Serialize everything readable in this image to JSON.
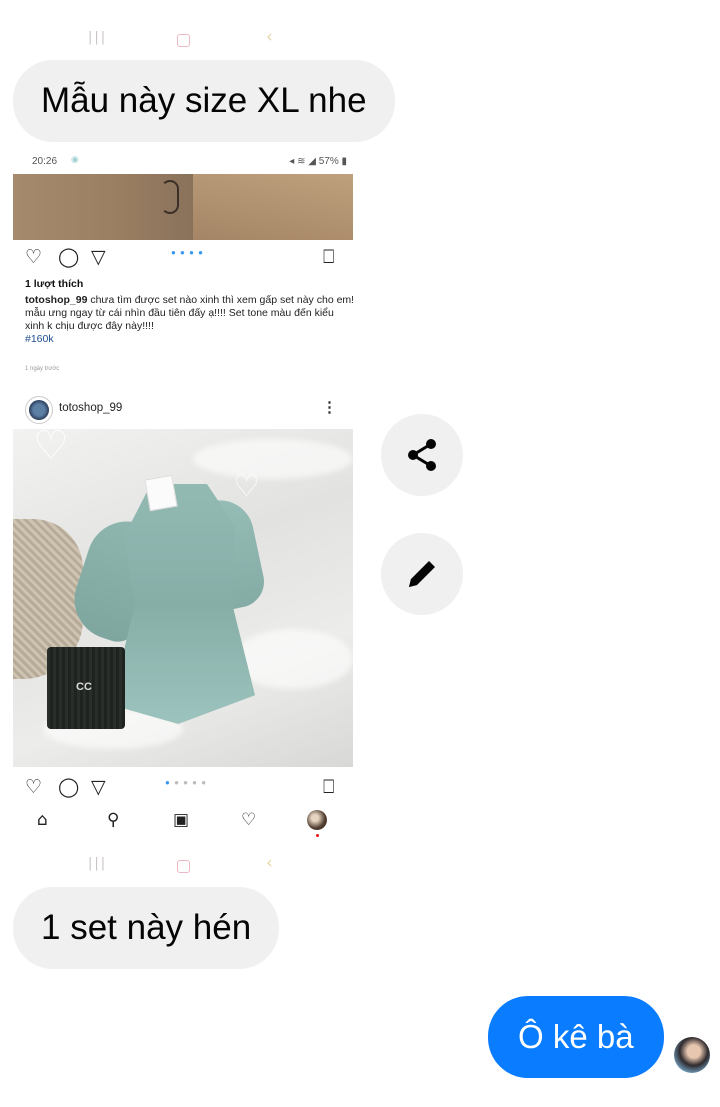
{
  "messages": {
    "msg1": "Mẫu này size XL nhe",
    "msg2": "1 set này hén",
    "reply": "Ô kê bà"
  },
  "screenshot": {
    "status_time": "20:26",
    "status_right": "57%",
    "likes": "1 lượt thích",
    "caption_user": "totoshop_99",
    "caption_text": " chưa tìm được set nào xinh thì xem gấp set này cho em! mẫu ưng ngay từ cái nhìn đầu tiên đấy ạ!!!! Set tone màu đến kiểu xinh k chịu được đây này!!!!",
    "caption_tag": "#160k",
    "time_ago": "1 ngày trước",
    "post_username": "totoshop_99",
    "bag_logo": "CC"
  },
  "icons": {
    "share": "share-icon",
    "edit": "pencil-icon"
  },
  "colors": {
    "incoming_bubble": "#f0f0f0",
    "outgoing_bubble": "#0a7cff"
  }
}
